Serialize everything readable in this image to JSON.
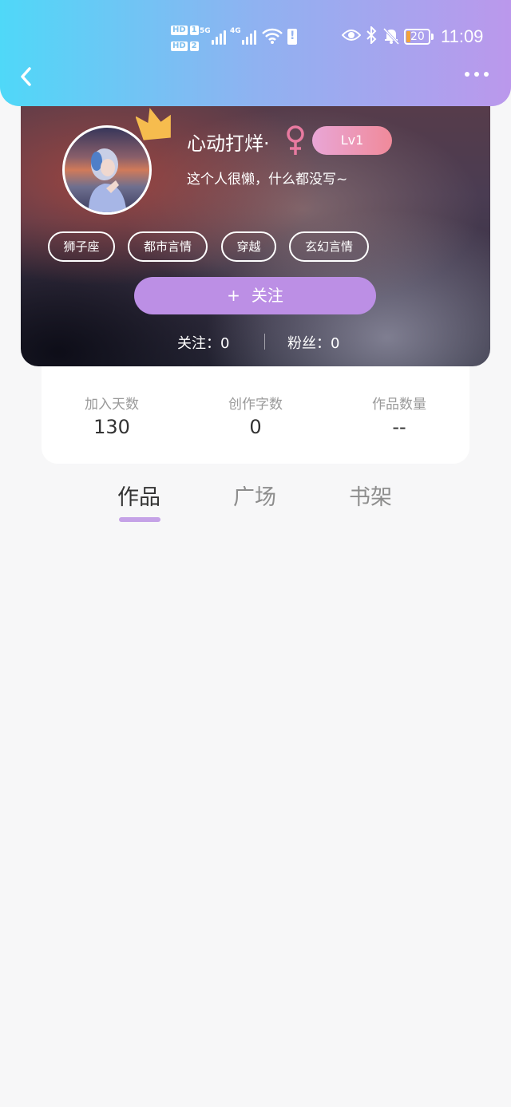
{
  "status_bar": {
    "hd1": "HD",
    "hd1_num": "1",
    "hd2": "HD",
    "hd2_num": "2",
    "sim1_gen": "5G",
    "sim2_gen": "4G",
    "battery": "20",
    "time": "11:09",
    "icons": [
      "eye-icon",
      "bluetooth-icon",
      "bell-off-icon",
      "wifi-icon",
      "alert-icon"
    ]
  },
  "nav": {
    "back_icon": "chevron-left-icon",
    "more_icon": "more-dots-icon"
  },
  "profile": {
    "nickname": "心动打烊·",
    "gender_icon": "female-icon",
    "level": "Lv1",
    "bio": "这个人很懒，什么都没写~",
    "tags": [
      "狮子座",
      "都市言情",
      "穿越",
      "玄幻言情"
    ],
    "follow_label": "关注",
    "follow_plus": "+",
    "following_label": "关注：",
    "following_count": "0",
    "fans_label": "粉丝：",
    "fans_count": "0"
  },
  "stats": [
    {
      "label": "加入天数",
      "value": "130"
    },
    {
      "label": "创作字数",
      "value": "0"
    },
    {
      "label": "作品数量",
      "value": "--"
    }
  ],
  "tabs": [
    {
      "label": "作品",
      "active": true
    },
    {
      "label": "广场",
      "active": false
    },
    {
      "label": "书架",
      "active": false
    }
  ],
  "colors": {
    "header_start": "#4fd8f8",
    "header_end": "#bb98ec",
    "accent": "#bc8fe5",
    "tab_indicator": "#c5a2e7",
    "level_badge": "#f08a9a",
    "female": "#e87aa0"
  }
}
